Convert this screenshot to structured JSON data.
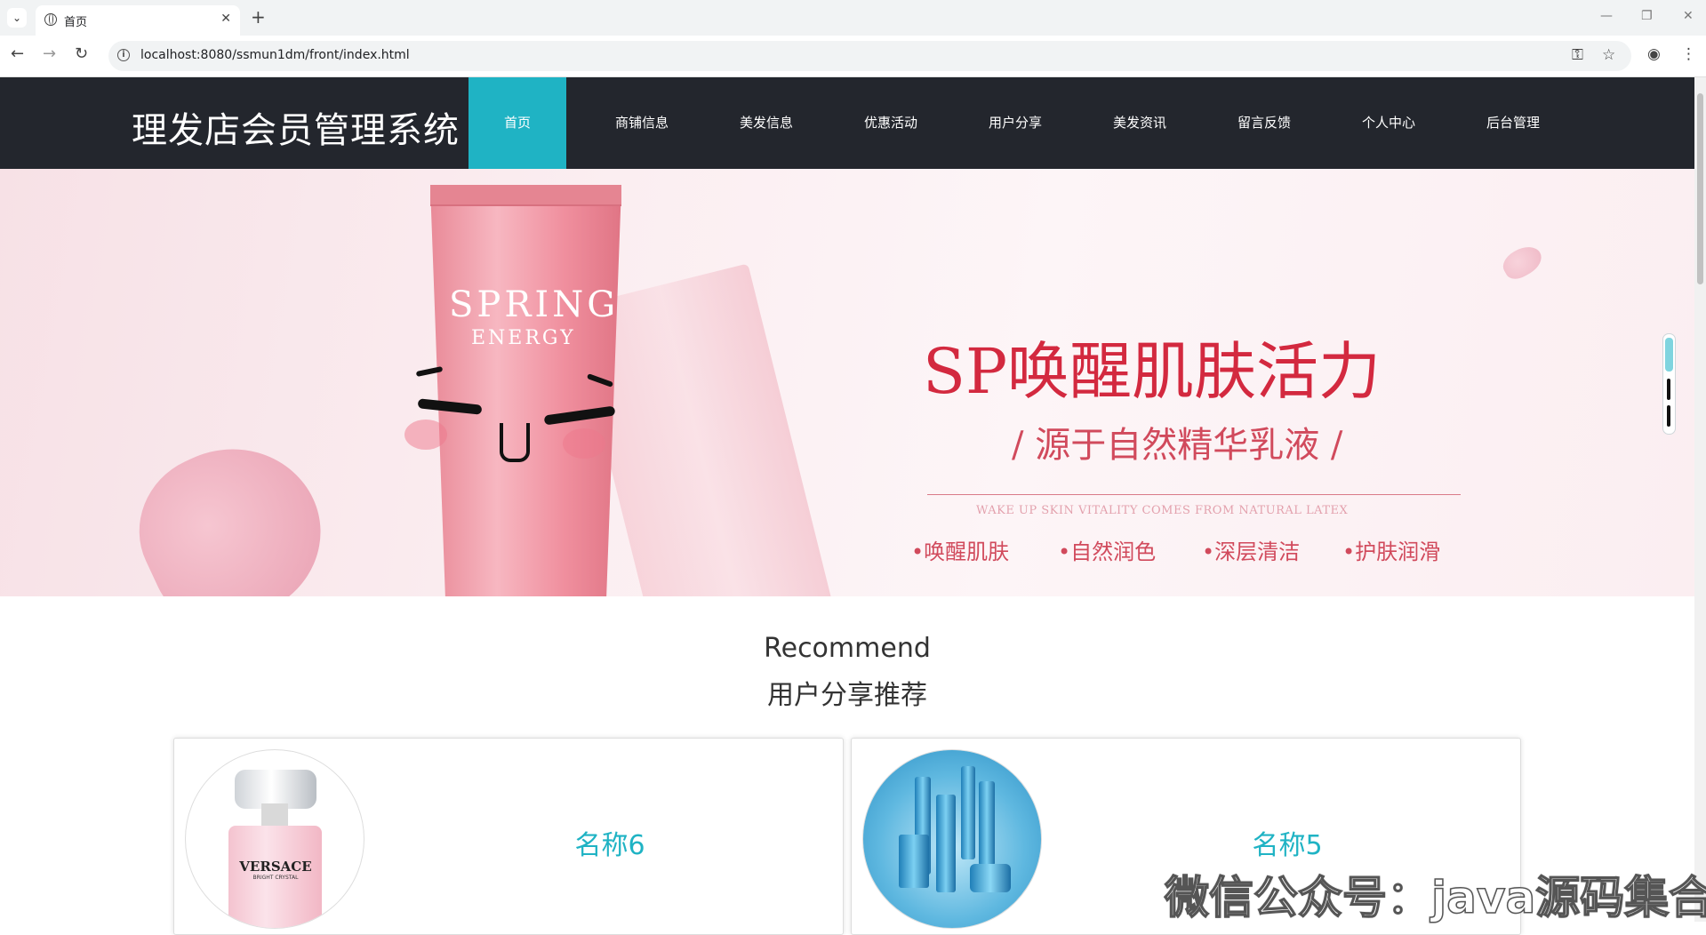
{
  "browser": {
    "tab_title": "首页",
    "url": "localhost:8080/ssmun1dm/front/index.html"
  },
  "site": {
    "title": "理发店会员管理系统",
    "nav": [
      {
        "label": "首页",
        "active": true
      },
      {
        "label": "商铺信息"
      },
      {
        "label": "美发信息"
      },
      {
        "label": "优惠活动"
      },
      {
        "label": "用户分享"
      },
      {
        "label": "美发资讯"
      },
      {
        "label": "留言反馈"
      },
      {
        "label": "个人中心"
      },
      {
        "label": "后台管理"
      }
    ],
    "accent": "#1fb3c4",
    "header_bg": "#23262d"
  },
  "banner": {
    "tube_brand": "SPRING",
    "tube_sub": "ENERGY",
    "headline": "SP唤醒肌肤活力",
    "subline": "/ 源于自然精华乳液 /",
    "english": "WAKE UP SKIN VITALITY COMES FROM NATURAL LATEX",
    "features": [
      "•唤醒肌肤",
      "•自然润色",
      "•深层清洁",
      "•护肤润滑"
    ]
  },
  "recommend": {
    "title_en": "Recommend",
    "title_cn": "用户分享推荐",
    "cards": [
      {
        "name": "名称6",
        "image": "perfume",
        "brand_label": "VERSACE",
        "brand_sub": "BRIGHT CRYSTAL"
      },
      {
        "name": "名称5",
        "image": "blue-cosmetics"
      }
    ]
  },
  "watermark": "微信公众号：java源码集合"
}
